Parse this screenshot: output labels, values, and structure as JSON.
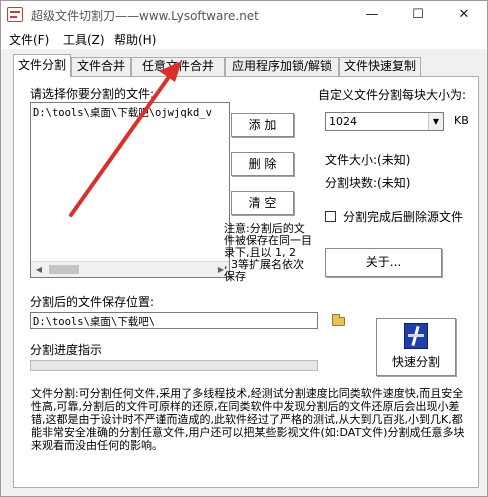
{
  "window": {
    "title": "超级文件切割刀——www.Lysoftware.net",
    "min_glyph": "—",
    "max_glyph": "☐",
    "close_glyph": "✕"
  },
  "menu": [
    "文件(F)",
    "工具(Z)",
    "帮助(H)"
  ],
  "tabs": [
    "文件分割",
    "文件合并",
    "任意文件合并",
    "应用程序加锁/解锁",
    "文件快速复制"
  ],
  "split": {
    "select_label": "请选择你要分割的文件:",
    "files": [
      "D:\\tools\\桌面\\下载吧\\ojwjqkd_v"
    ],
    "add_button": "添  加",
    "delete_button": "删  除",
    "clear_button": "清  空",
    "custom_size_label": "自定义文件分割每块大小为:",
    "size_value": "1024",
    "size_unit": "KB",
    "file_size_label": "文件大小:(未知)",
    "block_count_label": "分割块数:(未知)",
    "delete_source_label": "分割完成后删除源文件",
    "delete_source_checked": false,
    "note": "注意:分割后的文\n件被保存在同一目\n录下,且以 1, 2\n, 3等扩展名依次\n保存",
    "about_button": "关于...",
    "save_location_label": "分割后的文件保存位置:",
    "save_path": "D:\\tools\\桌面\\下载吧\\",
    "progress_label": "分割进度指示",
    "progress_value": 0,
    "quick_split_button": "快速分割",
    "description": "文件分割:可分割任何文件,采用了多线程技术,经测试分割速度比同类软件速度快,而且安全性高,可靠,分割后的文件可原样的还原,在同类软件中发现分割后的文件还原后会出现小差错,这都是由于设计时不严谨而造成的,此软件经过了严格的测试,从大到几百兆,小到几K,都能非常安全准确的分割任意文件,用户还可以把某些影视文件(如:DAT文件)分割成任意多块来观看而没由任何的影响。"
  },
  "colors": {
    "accent_progress": "#06b025",
    "annotation_arrow": "#d9302a"
  },
  "icons": {
    "app": "scissors-app-icon",
    "folder": "folder-icon",
    "quick_split": "split-arrow-icon",
    "combo": "chevron-down-icon"
  }
}
